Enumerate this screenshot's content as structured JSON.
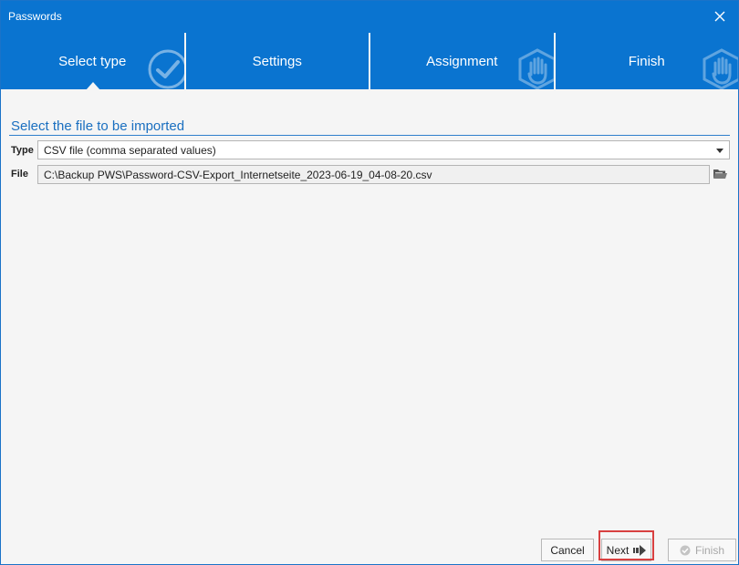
{
  "window": {
    "title": "Passwords"
  },
  "steps": [
    {
      "label": "Select type",
      "state": "active",
      "icon": "check-icon"
    },
    {
      "label": "Settings",
      "state": "pending",
      "icon": ""
    },
    {
      "label": "Assignment",
      "state": "pending",
      "icon": "hand-icon"
    },
    {
      "label": "Finish",
      "state": "pending",
      "icon": "hand-icon"
    }
  ],
  "section": {
    "title": "Select the file to be imported"
  },
  "form": {
    "type_label": "Type",
    "type_value": "CSV file (comma separated values)",
    "file_label": "File",
    "file_value": "C:\\Backup PWS\\Password-CSV-Export_Internetseite_2023-06-19_04-08-20.csv"
  },
  "buttons": {
    "cancel": "Cancel",
    "next": "Next",
    "finish": "Finish"
  },
  "colors": {
    "accent": "#0a74d0",
    "section_title": "#1a6fc0",
    "highlight": "#d84040"
  }
}
